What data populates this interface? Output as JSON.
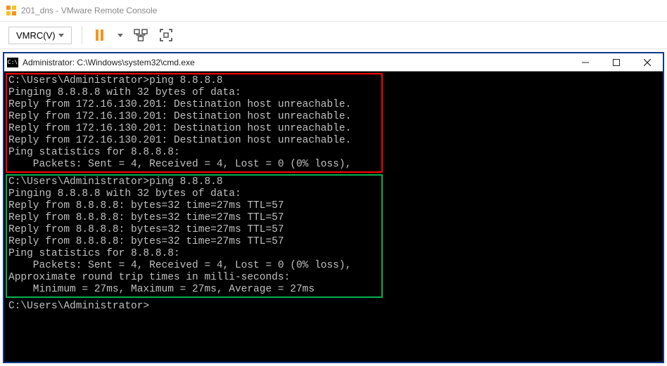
{
  "vmware": {
    "title": "201_dns - VMware Remote Console",
    "menu_label": "VMRC(V)"
  },
  "cmd": {
    "title": "Administrator: C:\\Windows\\system32\\cmd.exe"
  },
  "block1": {
    "l0": "C:\\Users\\Administrator>ping 8.8.8.8",
    "l1": "",
    "l2": "Pinging 8.8.8.8 with 32 bytes of data:",
    "l3": "Reply from 172.16.130.201: Destination host unreachable.",
    "l4": "Reply from 172.16.130.201: Destination host unreachable.",
    "l5": "Reply from 172.16.130.201: Destination host unreachable.",
    "l6": "Reply from 172.16.130.201: Destination host unreachable.",
    "l7": "",
    "l8": "Ping statistics for 8.8.8.8:",
    "l9": "    Packets: Sent = 4, Received = 4, Lost = 0 (0% loss),"
  },
  "block2": {
    "l0": "C:\\Users\\Administrator>ping 8.8.8.8",
    "l1": "",
    "l2": "Pinging 8.8.8.8 with 32 bytes of data:",
    "l3": "Reply from 8.8.8.8: bytes=32 time=27ms TTL=57",
    "l4": "Reply from 8.8.8.8: bytes=32 time=27ms TTL=57",
    "l5": "Reply from 8.8.8.8: bytes=32 time=27ms TTL=57",
    "l6": "Reply from 8.8.8.8: bytes=32 time=27ms TTL=57",
    "l7": "",
    "l8": "Ping statistics for 8.8.8.8:",
    "l9": "    Packets: Sent = 4, Received = 4, Lost = 0 (0% loss),",
    "l10": "Approximate round trip times in milli-seconds:",
    "l11": "    Minimum = 27ms, Maximum = 27ms, Average = 27ms"
  },
  "prompt": {
    "line": "C:\\Users\\Administrator>"
  }
}
